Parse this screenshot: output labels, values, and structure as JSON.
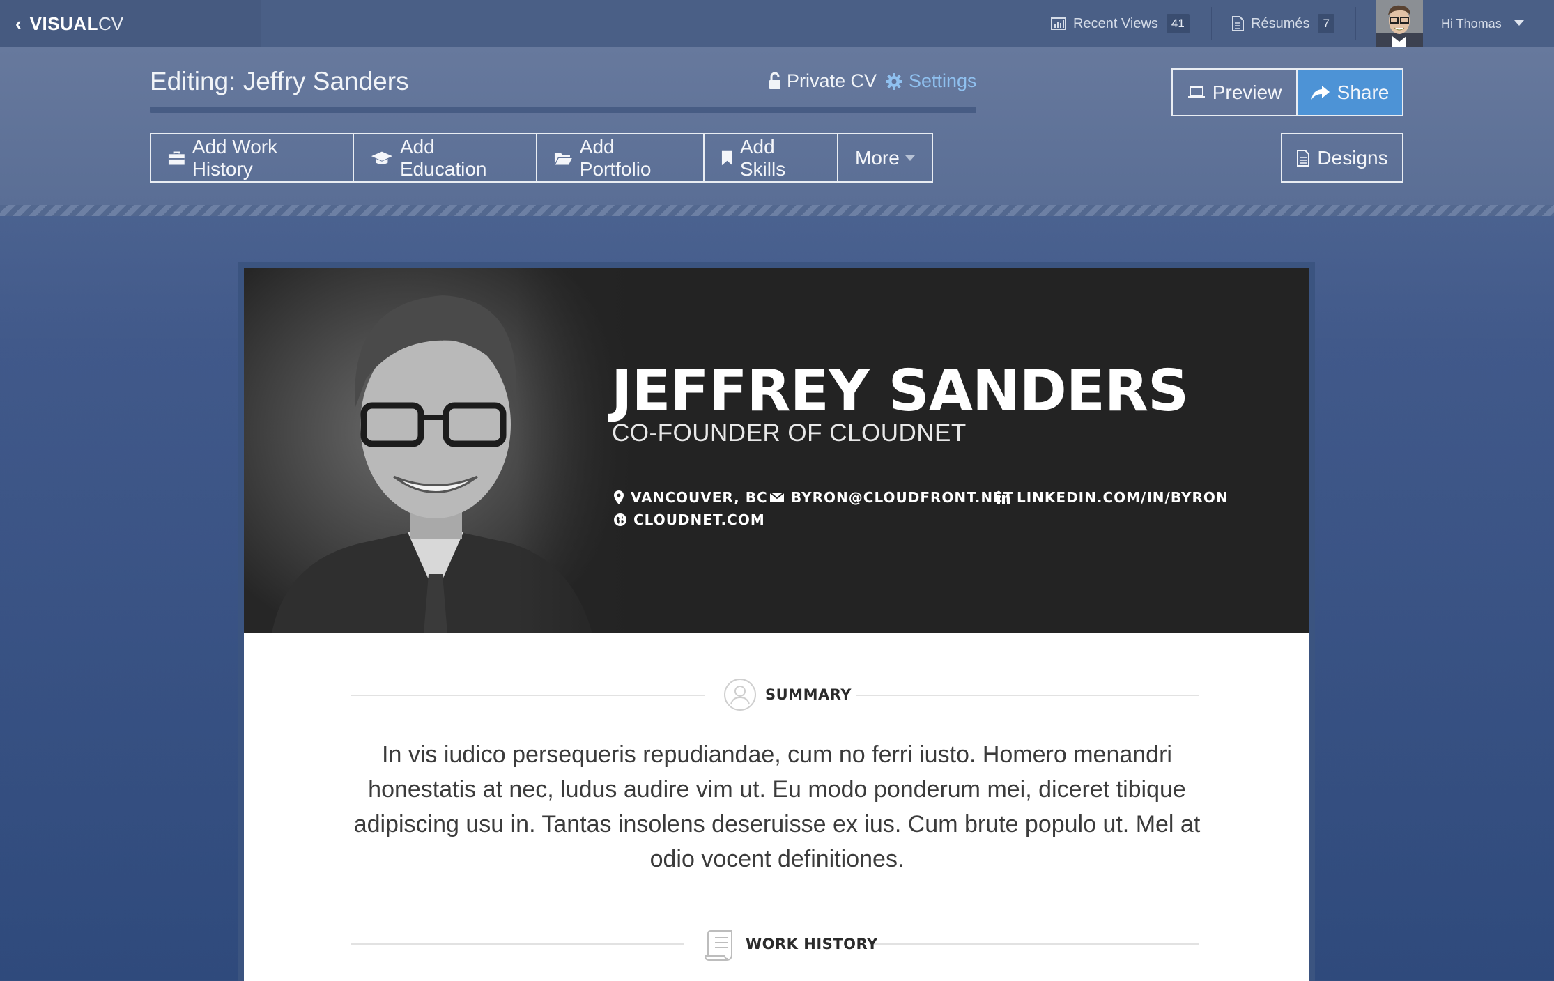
{
  "app": {
    "logo_bold": "VISUAL",
    "logo_light": "CV",
    "back_icon": "chevron-left-icon"
  },
  "topbar": {
    "recent_views_label": "Recent Views",
    "recent_views_count": "41",
    "resumes_label": "Résumés",
    "resumes_count": "7",
    "greeting": "Hi Thomas"
  },
  "editor": {
    "title": "Editing: Jeffry Sanders",
    "privacy_label": "Private CV",
    "settings_label": "Settings",
    "preview_label": "Preview",
    "share_label": "Share",
    "designs_label": "Designs",
    "add_buttons": [
      {
        "label": "Add Work History",
        "icon": "briefcase-icon"
      },
      {
        "label": "Add Education",
        "icon": "graduation-cap-icon"
      },
      {
        "label": "Add Portfolio",
        "icon": "folder-open-icon"
      },
      {
        "label": "Add Skills",
        "icon": "bookmark-icon"
      },
      {
        "label": "More",
        "icon": "caret-down-icon"
      }
    ]
  },
  "cv": {
    "name": "JEFFREY SANDERS",
    "role": "CO-FOUNDER OF CLOUDNET",
    "contacts": {
      "location": "VANCOUVER, BC",
      "email": "BYRON@CLOUDFRONT.NET",
      "linkedin": "LINKEDIN.COM/IN/BYRON",
      "website": "CLOUDNET.COM"
    },
    "summary_heading": "SUMMARY",
    "summary_text": "In vis iudico persequeris repudiandae, cum no ferri iusto. Homero menandri honestatis at nec, ludus audire vim ut. Eu modo ponderum mei, diceret tibique adipiscing usu in. Tantas insolens deseruisse ex ius. Cum brute populo ut. Mel at odio vocent definitiones.",
    "work_heading": "WORK HISTORY"
  },
  "colors": {
    "accent_blue": "#4d93d6",
    "settings_link": "#8fc0ef",
    "hero_bg": "#232323"
  }
}
